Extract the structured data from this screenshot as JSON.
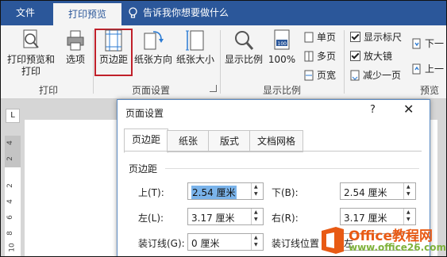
{
  "tabs": {
    "file": "文件",
    "print_preview": "打印预览",
    "tell_me": "告诉我你想要做什么"
  },
  "ribbon": {
    "print_preview_print": [
      "打印预览和",
      "打印"
    ],
    "options": "选项",
    "margins": "页边距",
    "orientation": "纸张方向",
    "size": "纸张大小",
    "zoom": "显示比例",
    "hundred": "100%",
    "single_page": "单页",
    "multi_page": "多页",
    "page_width": "页宽",
    "show_ruler": "显示标尺",
    "magnifier": "放大镜",
    "shrink_one_page": "减少一页",
    "next_page": "下一",
    "prev_page": "上一",
    "groups": {
      "print": "打印",
      "page_setup": "页面设置",
      "zoom": "显示比例",
      "preview": "预览"
    }
  },
  "ruler": {
    "corner": "L",
    "vertical_numbers": [
      "4",
      "2",
      "2",
      "4",
      "6",
      "8",
      "10"
    ]
  },
  "dialog": {
    "title": "页面设置",
    "help": "?",
    "close": "✕",
    "tabs": [
      "页边距",
      "纸张",
      "版式",
      "文档网格"
    ],
    "section": "页边距",
    "top_label": "上(T):",
    "top_value": "2.54 厘米",
    "bottom_label": "下(B):",
    "bottom_value": "2.54 厘米",
    "left_label": "左(L):",
    "left_value": "3.17 厘米",
    "right_label": "右(R):",
    "right_value": "3.17 厘米",
    "gutter_label": "装订线(G):",
    "gutter_value": "0 厘米",
    "gutter_pos_label": "装订线位置",
    "gutter_pos_value": "左"
  },
  "watermark": {
    "brand": "Office教程网",
    "url": "www.office26.com"
  },
  "colors": {
    "accent": "#2b579a",
    "highlight_border": "#c0202a",
    "watermark_orange": "#e85a14",
    "watermark_green": "#7fb23b"
  }
}
